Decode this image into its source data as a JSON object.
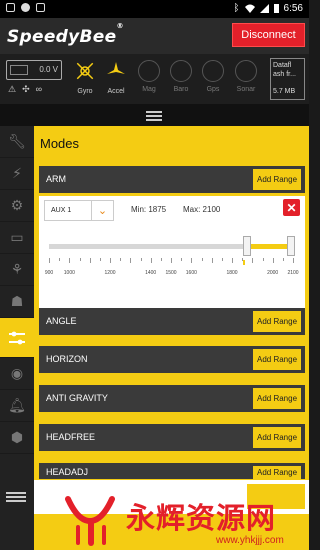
{
  "status_bar": {
    "time": "6:56",
    "left_icons": [
      "notification-square-icon",
      "notification-circle-icon",
      "notification-square-icon"
    ],
    "right_icons": [
      "bluetooth-icon",
      "wifi-icon",
      "signal-icon",
      "battery-icon"
    ]
  },
  "header": {
    "logo_text": "SpeedyBee",
    "logo_mark": "®",
    "disconnect_label": "Disconnect"
  },
  "sensors": {
    "voltage": "0.0 V",
    "items": [
      {
        "label": "Gyro",
        "icon": "gyro-icon",
        "active": true
      },
      {
        "label": "Accel",
        "icon": "accel-icon",
        "active": true
      },
      {
        "label": "Mag",
        "icon": "mag-icon",
        "active": false
      },
      {
        "label": "Baro",
        "icon": "baro-icon",
        "active": false
      },
      {
        "label": "Gps",
        "icon": "gps-icon",
        "active": false
      },
      {
        "label": "Sonar",
        "icon": "sonar-icon",
        "active": false
      }
    ],
    "dataflash_label": "Datafl ash fr...",
    "dataflash_size": "5.7 MB"
  },
  "sidebar": {
    "items": [
      "wrench-icon",
      "plug-icon",
      "gear-icon",
      "battery-icon",
      "hierarchy-icon",
      "robot-icon",
      "sliders-icon",
      "disc-icon",
      "bell-icon",
      "cube-icon"
    ],
    "active_index": 6
  },
  "main": {
    "title": "Modes",
    "add_range_label": "Add Range",
    "modes": [
      "ARM",
      "ANGLE",
      "HORIZON",
      "ANTI GRAVITY",
      "HEADFREE",
      "HEADADJ"
    ],
    "range": {
      "aux": "AUX 1",
      "min_label": "Min: 1875",
      "max_label": "Max: 2100",
      "min": 1875,
      "max": 2100,
      "scale_min": 900,
      "scale_max": 2100,
      "current": 1855,
      "tick_labels": [
        "900",
        "1000",
        "1200",
        "1400",
        "1500",
        "1600",
        "1800",
        "2000",
        "2100"
      ]
    }
  },
  "watermark": {
    "text": "永辉资源网",
    "url": "www.yhkjjj.com"
  },
  "colors": {
    "accent": "#f4cc13",
    "danger": "#e3202a",
    "row_bg": "#3a3a3a"
  }
}
